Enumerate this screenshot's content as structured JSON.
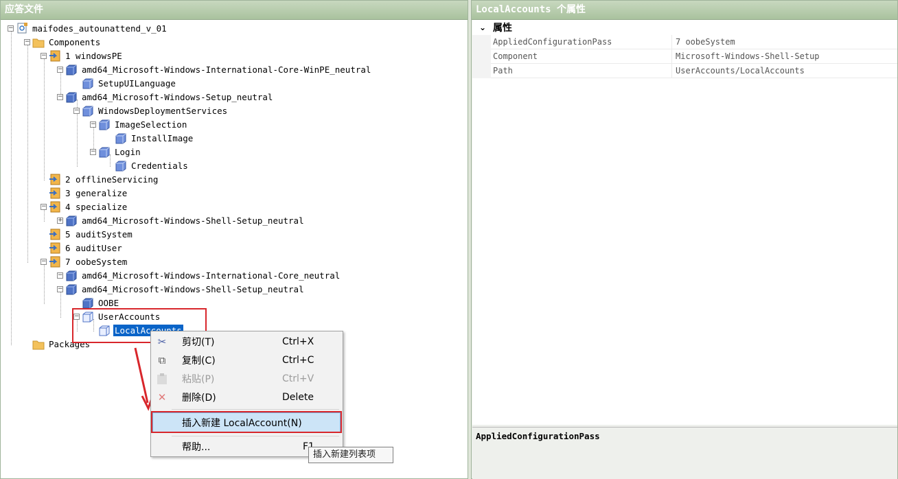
{
  "left_pane": {
    "title": "应答文件"
  },
  "right_pane": {
    "title": "LocalAccounts 个属性"
  },
  "tree": {
    "nodes": [
      {
        "label": "maifodes_autounattend_v_01",
        "icon": "answer-file-icon",
        "expander": "minus"
      },
      {
        "label": "Components",
        "icon": "folder-icon",
        "expander": "minus"
      },
      {
        "label": "1 windowsPE",
        "icon": "pass-icon",
        "expander": "minus"
      },
      {
        "label": "amd64_Microsoft-Windows-International-Core-WinPE_neutral",
        "icon": "component-icon",
        "expander": "minus"
      },
      {
        "label": "SetupUILanguage",
        "icon": "setting-icon",
        "expander": "none"
      },
      {
        "label": "amd64_Microsoft-Windows-Setup_neutral",
        "icon": "component-icon",
        "expander": "minus"
      },
      {
        "label": "WindowsDeploymentServices",
        "icon": "setting-icon",
        "expander": "minus"
      },
      {
        "label": "ImageSelection",
        "icon": "setting-icon",
        "expander": "minus"
      },
      {
        "label": "InstallImage",
        "icon": "setting-icon",
        "expander": "none"
      },
      {
        "label": "Login",
        "icon": "setting-icon",
        "expander": "minus"
      },
      {
        "label": "Credentials",
        "icon": "setting-icon",
        "expander": "none"
      },
      {
        "label": "2 offlineServicing",
        "icon": "pass-icon",
        "expander": "none"
      },
      {
        "label": "3 generalize",
        "icon": "pass-icon",
        "expander": "none"
      },
      {
        "label": "4 specialize",
        "icon": "pass-icon",
        "expander": "minus"
      },
      {
        "label": "amd64_Microsoft-Windows-Shell-Setup_neutral",
        "icon": "component-icon",
        "expander": "plus"
      },
      {
        "label": "5 auditSystem",
        "icon": "pass-icon",
        "expander": "none"
      },
      {
        "label": "6 auditUser",
        "icon": "pass-icon",
        "expander": "none"
      },
      {
        "label": "7 oobeSystem",
        "icon": "pass-icon",
        "expander": "minus"
      },
      {
        "label": "amd64_Microsoft-Windows-International-Core_neutral",
        "icon": "component-icon",
        "expander": "minus"
      },
      {
        "label": "amd64_Microsoft-Windows-Shell-Setup_neutral",
        "icon": "component-icon",
        "expander": "minus"
      },
      {
        "label": "OOBE",
        "icon": "setting-icon",
        "expander": "none"
      },
      {
        "label": "UserAccounts",
        "icon": "list-setting-icon",
        "expander": "minus"
      },
      {
        "label": "LocalAccounts",
        "icon": "list-setting-icon",
        "expander": "none",
        "selected": true
      },
      {
        "label": "Packages",
        "icon": "folder-icon",
        "expander": "none"
      }
    ]
  },
  "context_menu": {
    "items": [
      {
        "label": "剪切(T)",
        "shortcut": "Ctrl+X",
        "icon": "scissors-icon",
        "glyph": "✂",
        "disabled": false
      },
      {
        "label": "复制(C)",
        "shortcut": "Ctrl+C",
        "icon": "copy-icon",
        "glyph": "⧉",
        "disabled": false
      },
      {
        "label": "粘贴(P)",
        "shortcut": "Ctrl+V",
        "icon": "paste-icon",
        "glyph": "📋",
        "disabled": true
      },
      {
        "label": "删除(D)",
        "shortcut": "Delete",
        "icon": "delete-icon",
        "glyph": "✕",
        "disabled": false
      },
      {
        "label": "插入新建 LocalAccount(N)",
        "shortcut": "",
        "icon": "",
        "glyph": "",
        "disabled": false,
        "active": true
      },
      {
        "label": "帮助...",
        "shortcut": "F1",
        "icon": "",
        "glyph": "",
        "disabled": false
      }
    ]
  },
  "tooltip": {
    "text": "插入新建列表项"
  },
  "properties": {
    "category": "属性",
    "rows": [
      {
        "name": "AppliedConfigurationPass",
        "value": "7 oobeSystem"
      },
      {
        "name": "Component",
        "value": "Microsoft-Windows-Shell-Setup"
      },
      {
        "name": "Path",
        "value": "UserAccounts/LocalAccounts"
      }
    ],
    "description_title": "AppliedConfigurationPass"
  },
  "colors": {
    "highlight_box": "#d8262b",
    "selection": "#0a64c8",
    "menu_active": "#cce4f7"
  }
}
